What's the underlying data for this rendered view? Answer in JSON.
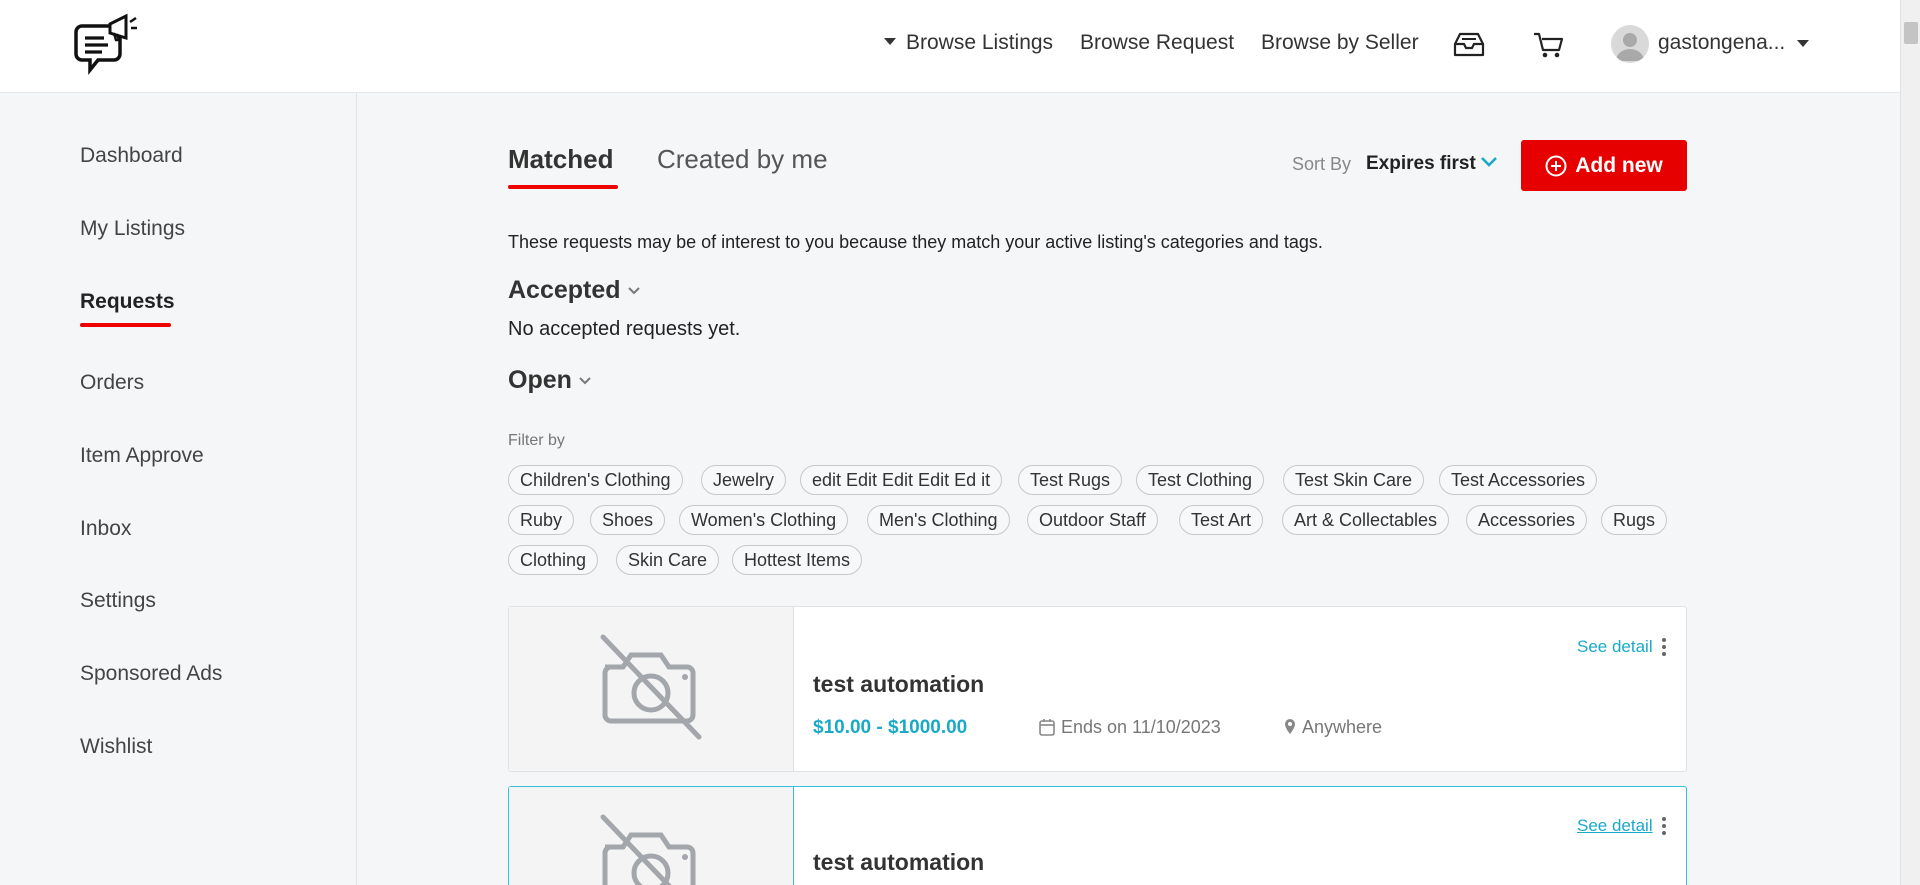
{
  "header": {
    "nav": {
      "browse_listings": "Browse Listings",
      "browse_request": "Browse Request",
      "browse_by_seller": "Browse by Seller"
    },
    "user": {
      "name": "gastongena..."
    }
  },
  "sidebar": {
    "items": [
      {
        "label": "Dashboard"
      },
      {
        "label": "My Listings"
      },
      {
        "label": "Requests"
      },
      {
        "label": "Orders"
      },
      {
        "label": "Item Approve"
      },
      {
        "label": "Inbox"
      },
      {
        "label": "Settings"
      },
      {
        "label": "Sponsored Ads"
      },
      {
        "label": "Wishlist"
      }
    ],
    "active": "Requests"
  },
  "tabs": [
    {
      "label": "Matched",
      "active": true
    },
    {
      "label": "Created by me",
      "active": false
    }
  ],
  "sort": {
    "label": "Sort By",
    "value": "Expires first"
  },
  "add_button": {
    "label": "Add new"
  },
  "intro": "These requests may be of interest to you because they match your active listing's categories and tags.",
  "accepted": {
    "title": "Accepted",
    "empty": "No accepted requests yet."
  },
  "open": {
    "title": "Open"
  },
  "filter": {
    "label": "Filter by",
    "chips": [
      "Children's Clothing",
      "Jewelry",
      "edit Edit Edit Edit Ed it",
      "Test Rugs",
      "Test Clothing",
      "Test Skin Care",
      "Test Accessories",
      "Ruby",
      "Shoes",
      "Women's Clothing",
      "Men's Clothing",
      "Outdoor Staff",
      "Test Art",
      "Art & Collectables",
      "Accessories",
      "Rugs",
      "Clothing",
      "Skin Care",
      "Hottest Items"
    ]
  },
  "cards": [
    {
      "title": "test automation",
      "price": "$10.00 - $1000.00",
      "ends": "Ends on 11/10/2023",
      "location": "Anywhere",
      "see_detail": "See detail"
    },
    {
      "title": "test automation",
      "see_detail": "See detail"
    }
  ],
  "colors": {
    "accent_red": "#e60000",
    "accent_cyan": "#1aa9c7"
  }
}
